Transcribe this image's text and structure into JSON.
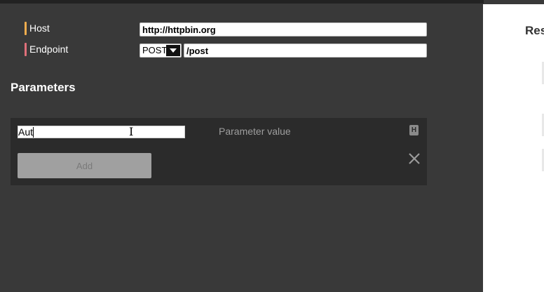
{
  "request": {
    "host": {
      "label": "Host",
      "value": "http://httpbin.org"
    },
    "endpoint": {
      "label": "Endpoint",
      "method": "POST",
      "path": "/post"
    }
  },
  "parameters": {
    "title": "Parameters",
    "key_value": "Aut",
    "value_placeholder": "Parameter value",
    "header_icon_letter": "H",
    "add_label": "Add"
  },
  "right_panel": {
    "title_fragment": "Res"
  },
  "colors": {
    "host_accent": "#f0ad4e",
    "endpoint_accent": "#e0707a"
  }
}
